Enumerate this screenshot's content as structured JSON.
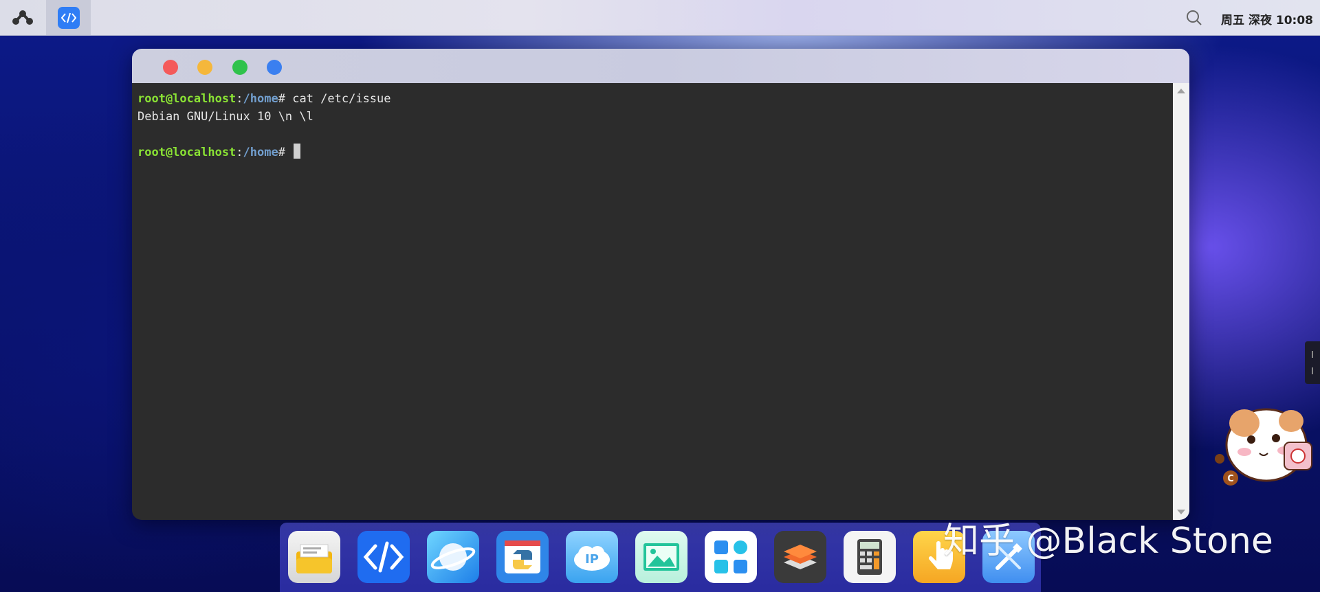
{
  "topbar": {
    "launcher_icon": "launcher-icon",
    "active_app_icon": "code-editor-icon",
    "search_icon": "search-icon",
    "clock": "周五 深夜 10:08"
  },
  "window": {
    "controls": [
      "close",
      "minimize",
      "maximize",
      "extra"
    ],
    "terminal": {
      "lines": [
        {
          "user": "root@localhost",
          "colon": ":",
          "path": "/home",
          "hash": "# ",
          "command": "cat /etc/issue"
        },
        {
          "text": "Debian GNU/Linux 10 \\n \\l"
        },
        {
          "text": ""
        },
        {
          "user": "root@localhost",
          "colon": ":",
          "path": "/home",
          "hash": "# ",
          "command": ""
        }
      ]
    }
  },
  "dock": {
    "items": [
      {
        "name": "file-manager",
        "icon": "folder-icon"
      },
      {
        "name": "code-editor",
        "icon": "code-icon"
      },
      {
        "name": "browser",
        "icon": "planet-icon"
      },
      {
        "name": "python-ide",
        "icon": "python-icon"
      },
      {
        "name": "ip-tool",
        "icon": "ip-cloud-icon"
      },
      {
        "name": "image-viewer",
        "icon": "image-icon"
      },
      {
        "name": "app-store",
        "icon": "apps-grid-icon"
      },
      {
        "name": "layers",
        "icon": "layers-icon"
      },
      {
        "name": "calculator",
        "icon": "calculator-icon"
      },
      {
        "name": "touch",
        "icon": "hand-pointer-icon"
      },
      {
        "name": "settings-tools",
        "icon": "tools-icon"
      }
    ]
  },
  "watermark": "知乎 @Black Stone",
  "colors": {
    "prompt_user": "#8ae234",
    "prompt_path": "#729fcf",
    "terminal_bg": "#2c2c2c",
    "close": "#f45a5a",
    "minimize": "#f5b73b",
    "maximize": "#2fc24b",
    "extra": "#3a7ff0"
  }
}
